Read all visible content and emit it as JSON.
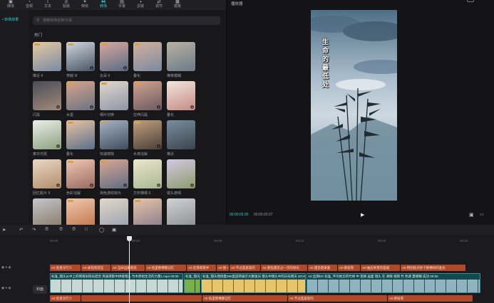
{
  "toolbar": {
    "items": [
      {
        "label": "媒体",
        "icon": "media-icon"
      },
      {
        "label": "音频",
        "icon": "audio-icon"
      },
      {
        "label": "文本",
        "icon": "text-icon"
      },
      {
        "label": "贴纸",
        "icon": "sticker-icon"
      },
      {
        "label": "特效",
        "icon": "effects-icon"
      },
      {
        "label": "转场",
        "icon": "transition-icon"
      },
      {
        "label": "字幕",
        "icon": "subtitle-icon"
      },
      {
        "label": "滤镜",
        "icon": "filter-icon"
      },
      {
        "label": "调节",
        "icon": "adjust-icon"
      },
      {
        "label": "模板",
        "icon": "template-icon"
      }
    ],
    "active_index": 5
  },
  "sidenav": {
    "active_label": "• 转场效果"
  },
  "search": {
    "placeholder": "搜索转场名称/元素"
  },
  "effects": {
    "section_title": "热门",
    "items": [
      {
        "name": "推近 II",
        "c1": "#e6c9a3",
        "c2": "#7a8aa2",
        "vip": true,
        "dl": false
      },
      {
        "name": "穿越 III",
        "c1": "#cfd6df",
        "c2": "#4a5564",
        "vip": true,
        "dl": true
      },
      {
        "name": "云朵 II",
        "c1": "#d8a9a1",
        "c2": "#5a6a82",
        "vip": true,
        "dl": true
      },
      {
        "name": "叠化",
        "c1": "#d2b09e",
        "c2": "#7c8aa0",
        "vip": true,
        "dl": false
      },
      {
        "name": "横移模糊",
        "c1": "#b9b2a4",
        "c2": "#6b7a88",
        "vip": false,
        "dl": false
      },
      {
        "name": "闪黑",
        "c1": "#4a4c58",
        "c2": "#a38a7a",
        "vip": false,
        "dl": true
      },
      {
        "name": "水墨",
        "c1": "#d8a48c",
        "c2": "#6a7284",
        "vip": true,
        "dl": true
      },
      {
        "name": "相片切换",
        "c1": "#e2d8cc",
        "c2": "#8d96a6",
        "vip": true,
        "dl": false
      },
      {
        "name": "拉伸闪黑",
        "c1": "#d4a38e",
        "c2": "#6a5a62",
        "vip": true,
        "dl": true
      },
      {
        "name": "叠化",
        "c1": "#f2e6de",
        "c2": "#c58b84",
        "vip": false,
        "dl": true
      },
      {
        "name": "泰日光斑",
        "c1": "#eaf0e8",
        "c2": "#8ca07e",
        "vip": false,
        "dl": true
      },
      {
        "name": "叠化",
        "c1": "#e9c3a4",
        "c2": "#5a6f8a",
        "vip": true,
        "dl": false
      },
      {
        "name": "快速擦除",
        "c1": "#a7b4c4",
        "c2": "#3f4c5e",
        "vip": true,
        "dl": false
      },
      {
        "name": "水滴溶解",
        "c1": "#c2a07e",
        "c2": "#4a3f3a",
        "vip": true,
        "dl": true
      },
      {
        "name": "推近",
        "c1": "#7a8e9e",
        "c2": "#3a444e",
        "vip": false,
        "dl": false
      },
      {
        "name": "回忆胶片 II",
        "c1": "#ead8c4",
        "c2": "#b38c6c",
        "vip": false,
        "dl": true
      },
      {
        "name": "色彩溶解",
        "c1": "#f0c8b2",
        "c2": "#9a6a62",
        "vip": true,
        "dl": true
      },
      {
        "name": "渐色波纹转片",
        "c1": "#d9a894",
        "c2": "#5f6c84",
        "vip": true,
        "dl": true
      },
      {
        "name": "方形梯晴 II",
        "c1": "#eee6cf",
        "c2": "#a6b890",
        "vip": false,
        "dl": true
      },
      {
        "name": "镜头遮晴",
        "c1": "#d2c9e4",
        "c2": "#8e9a6c",
        "vip": false,
        "dl": true
      },
      {
        "name": "",
        "c1": "#c4c6ca",
        "c2": "#8a7a6a",
        "vip": false,
        "dl": false
      },
      {
        "name": "",
        "c1": "#f0c8b0",
        "c2": "#c0764c",
        "vip": true,
        "dl": false
      },
      {
        "name": "",
        "c1": "#e2d8c8",
        "c2": "#9aa2b0",
        "vip": false,
        "dl": false
      },
      {
        "name": "",
        "c1": "#e6c4a8",
        "c2": "#8a7c8c",
        "vip": true,
        "dl": false
      },
      {
        "name": "",
        "c1": "#d0d2d6",
        "c2": "#8c8e92",
        "vip": false,
        "dl": false
      }
    ]
  },
  "player": {
    "title": "播放器",
    "overlay_text": "生命的最低处",
    "time_current": "00:00:03:26",
    "time_total": "00:00:20:07"
  },
  "timeline": {
    "ruler_ticks": [
      "00:00",
      "00:04",
      "00:08",
      "00:12",
      "00:16",
      "00:20"
    ],
    "cover_label": "封面",
    "text_clips": [
      {
        "label": "A0 星星没行人",
        "w": 44
      },
      {
        "label": "A0 却找到其证",
        "w": 42
      },
      {
        "label": "A0 当命运最暗处",
        "w": 48
      },
      {
        "label": "A0 低里那棵都记忆",
        "w": 58
      },
      {
        "label": "A0 坠落暗夜中",
        "w": 42
      },
      {
        "label": "A0 接一",
        "w": 18
      },
      {
        "label": "A0 不过是柔软的",
        "w": 44
      },
      {
        "label": "A0 我恒遇见过一次的绿光",
        "w": 66
      },
      {
        "label": "A0 遇见距离着",
        "w": 42
      },
      {
        "label": "A0 那枝卷",
        "w": 32
      },
      {
        "label": "A0 抽丝剥茧的是痕",
        "w": 56
      },
      {
        "label": "A0 特别低点你下那棵树的金光",
        "w": 92
      }
    ],
    "video_clips": [
      {
        "label": "标准_镜头从中上的明南树阳光结合 风质感影中拼接镜头 竹木原始生活的力量1.mp4 00:00",
        "w": 188,
        "c1": "#c8d8d4",
        "c2": "#4a6a5e"
      },
      {
        "label": "标准_镜头围绕着360度",
        "w": 24,
        "c1": "#7ab04c",
        "c2": "#2e4a1e"
      },
      {
        "label": "标准_镜头围绕着360度旋转展示大鹏金光 镜头中镜头中的日光明天 00:00",
        "w": 148,
        "c1": "#e8c46a",
        "c2": "#8a5e1a"
      },
      {
        "label": "A0 丝绸DX 标准_平均地云的竹林 中 变换 画面 镜头 在 清晰 视频 竹 色调 夏模糊 成功 00:00",
        "w": 245,
        "c1": "#8fb4c0",
        "c2": "#2e4e5a"
      }
    ],
    "sub_clips": [
      {
        "label": "A0 星星没行人",
        "w": 44
      },
      {
        "label": "",
        "w": 170
      },
      {
        "label": "A0 低里那棵都记忆",
        "w": 120
      },
      {
        "label": "A0 不过是柔软的",
        "w": 140
      },
      {
        "label": "A0 那枝卷",
        "w": 120
      }
    ]
  }
}
